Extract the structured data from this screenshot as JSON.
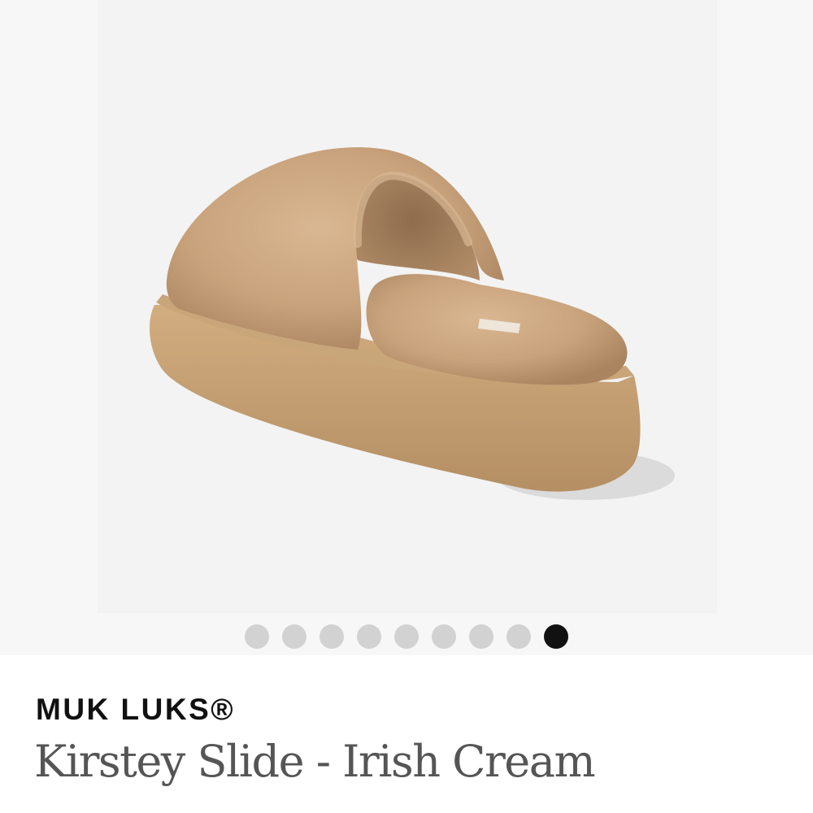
{
  "gallery": {
    "image": {
      "description": "product-photo",
      "colors": {
        "fur": "#c9a37c",
        "sole": "#c6a172",
        "background": "#f3f3f3"
      }
    },
    "dots": {
      "total": 9,
      "active_index": 8,
      "colors": {
        "inactive": "#d2d2d2",
        "active": "#111111"
      }
    }
  },
  "product": {
    "brand": "MUK LUKS®",
    "name": "Kirstey Slide - Irish Cream"
  }
}
